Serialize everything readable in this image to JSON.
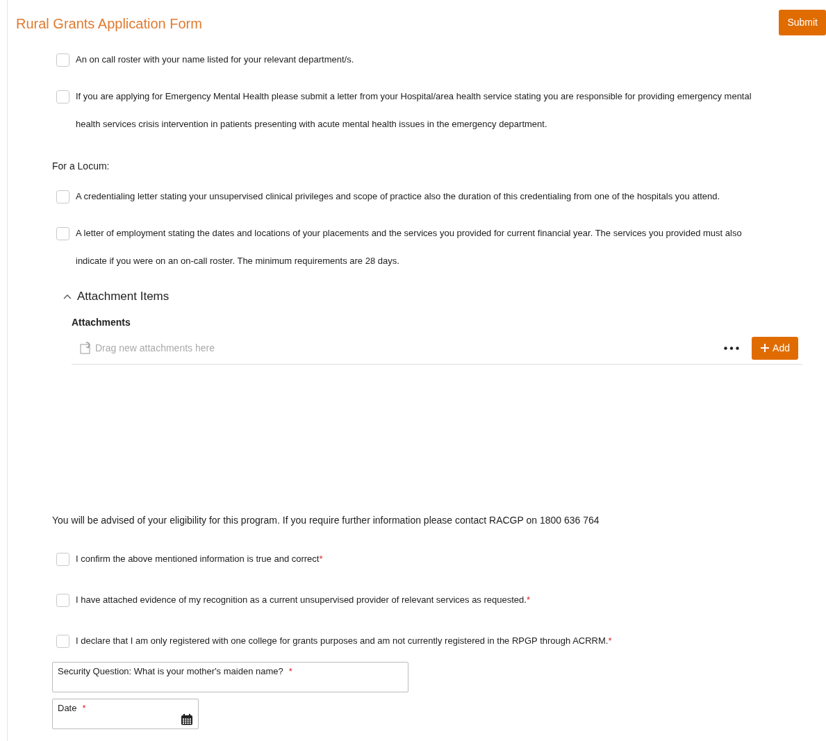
{
  "title": "Rural Grants Application Form",
  "submit_button": "Submit",
  "blocks": [
    {
      "kind": "checkbox",
      "label": "An on call roster with your name listed for your relevant department/s.",
      "checked": false
    },
    {
      "kind": "checkbox",
      "label": "If you are applying for Emergency Mental Health please submit a letter from your Hospital/area health service stating you are responsible for providing emergency mental health services crisis intervention in patients presenting with acute mental health issues in the emergency department.",
      "checked": false
    },
    {
      "kind": "heading",
      "label": "For a Locum:"
    },
    {
      "kind": "checkbox",
      "label": "A credentialing letter stating your unsupervised clinical privileges and scope of practice also the duration of this credentialing from one of the hospitals you attend.",
      "checked": false
    },
    {
      "kind": "checkbox",
      "label": "A letter of employment stating the dates and locations of your placements and the services you provided for current financial year. The services you provided must also indicate if you were on an on-call roster. The minimum requirements are 28 days.",
      "checked": false
    }
  ],
  "attachments": {
    "title": "Attachment Items",
    "expanded": true,
    "label": "Attachments",
    "placeholder": "Drag new attachments here",
    "add_button": "Add"
  },
  "notice": "You will be advised of your eligibility for this program. If you require further information please contact RACGP on 1800 636 764",
  "declarations": [
    {
      "label": "I confirm the above mentioned information is true and correct",
      "required_mark": "*",
      "checked": false
    },
    {
      "label": "I have attached evidence of my recognition as a current unsupervised provider of relevant services as requested.",
      "required_mark": "*",
      "checked": false
    },
    {
      "label": "I declare that I am only registered with one college for grants purposes and am not currently registered in the RPGP through ACRRM.",
      "required_mark": "*",
      "checked": false
    }
  ],
  "fields": [
    {
      "kind": "text",
      "label": "Security Question: What is your mother's maiden name?",
      "required_mark": "*"
    },
    {
      "kind": "date",
      "label": "Date",
      "required_mark": "*"
    }
  ]
}
